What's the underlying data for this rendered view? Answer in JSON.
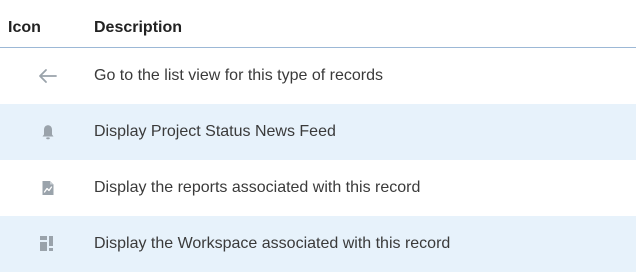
{
  "header": {
    "icon_label": "Icon",
    "description_label": "Description"
  },
  "rows": [
    {
      "icon": "back-arrow-icon",
      "description": "Go to the list view for this type of records"
    },
    {
      "icon": "bell-icon",
      "description": "Display Project Status News Feed"
    },
    {
      "icon": "report-icon",
      "description": "Display the reports associated with this record"
    },
    {
      "icon": "workspace-icon",
      "description": "Display the Workspace associated with this record"
    }
  ],
  "colors": {
    "header_border": "#9cb8d6",
    "alt_row": "#e7f2fb",
    "icon_gray": "#9aa3ab"
  }
}
